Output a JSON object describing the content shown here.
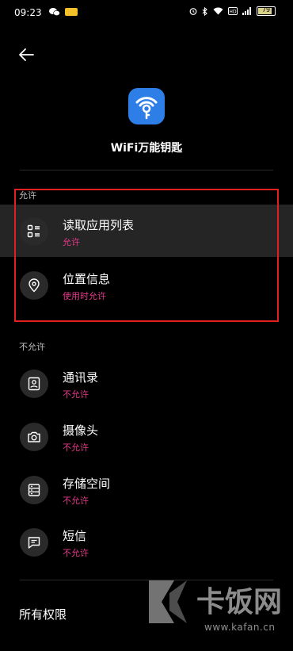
{
  "status_bar": {
    "time": "09:23",
    "battery": "79"
  },
  "app": {
    "name": "WiFi万能钥匙",
    "accent_color": "#2e7ee8"
  },
  "sections": {
    "allowed": {
      "label": "允许",
      "items": [
        {
          "title": "读取应用列表",
          "status": "允许",
          "icon": "list-icon"
        },
        {
          "title": "位置信息",
          "status": "使用时允许",
          "icon": "location-pin-icon"
        }
      ]
    },
    "denied": {
      "label": "不允许",
      "items": [
        {
          "title": "通讯录",
          "status": "不允许",
          "icon": "contacts-icon"
        },
        {
          "title": "摄像头",
          "status": "不允许",
          "icon": "camera-icon"
        },
        {
          "title": "存储空间",
          "status": "不允许",
          "icon": "storage-icon"
        },
        {
          "title": "短信",
          "status": "不允许",
          "icon": "sms-icon"
        }
      ]
    }
  },
  "footer": {
    "all_permissions": "所有权限"
  },
  "watermark": {
    "brand": "卡饭网",
    "url": "www.kafan.cn"
  },
  "colors": {
    "status_text": "#e4388a",
    "highlight_box": "#e02020"
  }
}
